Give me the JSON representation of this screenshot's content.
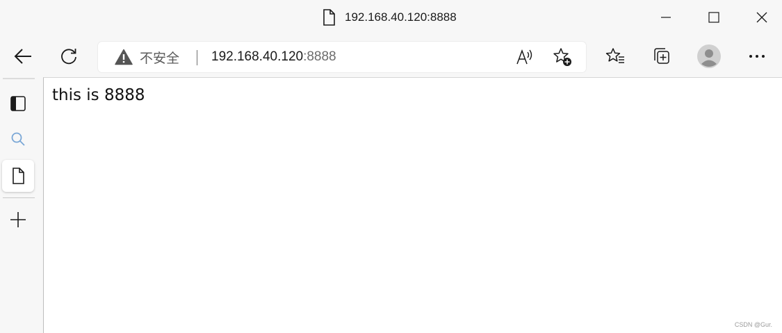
{
  "window": {
    "title": "192.168.40.120:8888"
  },
  "addressbar": {
    "security_label": "不安全",
    "url_host": "192.168.40.120",
    "url_port": ":8888"
  },
  "page": {
    "body_text": "this is 8888"
  },
  "watermark": "CSDN @Gur.",
  "icons": {
    "back": "back-arrow-icon",
    "refresh": "refresh-icon",
    "warning": "warning-icon",
    "read_aloud": "read-aloud-icon",
    "add_favorite": "add-favorite-icon",
    "favorites": "favorites-icon",
    "collections": "collections-icon",
    "profile": "profile-avatar",
    "more": "more-icon",
    "tab_actions": "tab-actions-icon",
    "search": "search-icon",
    "page": "page-icon",
    "new_tab": "plus-icon"
  },
  "colors": {
    "chrome_bg": "#f7f7f7",
    "content_bg": "#ffffff",
    "search_icon": "#7aa7d6"
  }
}
